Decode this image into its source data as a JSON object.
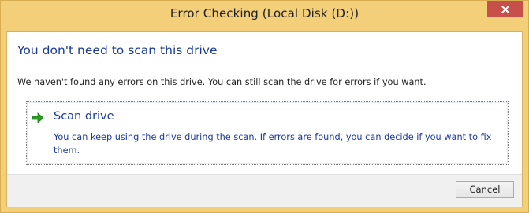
{
  "window": {
    "title": "Error Checking (Local Disk (D:))",
    "close_icon": "close-icon",
    "close_color": "#c7504a",
    "frame_color": "#f3cf7a"
  },
  "main": {
    "heading": "You don't need to scan this drive",
    "info": "We haven't found any errors on this drive. You can still scan the drive for errors if you want."
  },
  "scan_option": {
    "icon": "green-arrow-icon",
    "title": "Scan drive",
    "description": "You can keep using the drive during the scan. If errors are found, you can decide if you want to fix them."
  },
  "footer": {
    "cancel_label": "Cancel"
  },
  "colors": {
    "heading": "#1b3a9a",
    "arrow": "#2a9b22"
  }
}
